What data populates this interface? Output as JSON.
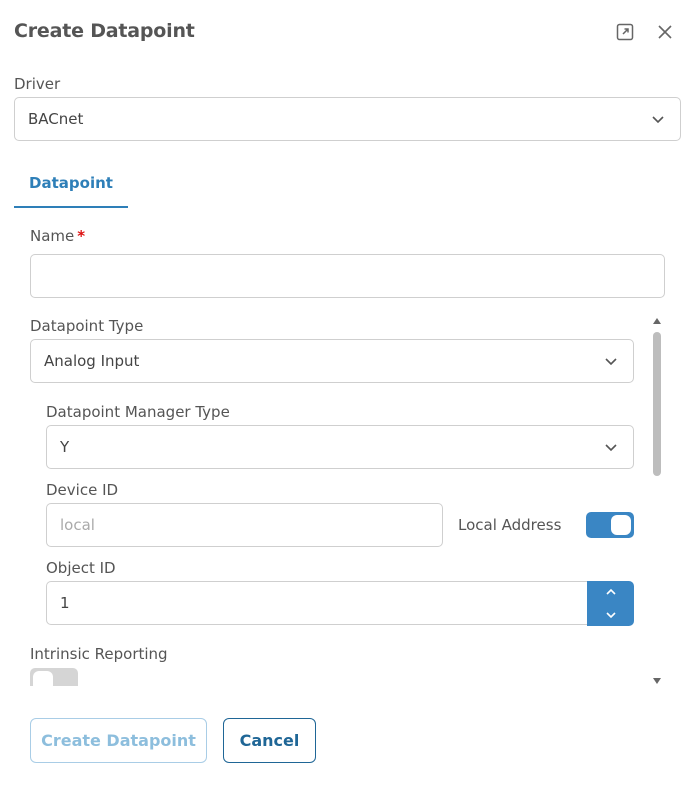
{
  "dialog": {
    "title": "Create Datapoint",
    "expand_icon": "expand-icon",
    "close_icon": "close-icon"
  },
  "driver": {
    "label": "Driver",
    "value": "BACnet"
  },
  "tabs": [
    {
      "label": "Datapoint",
      "active": true
    }
  ],
  "form": {
    "name": {
      "label": "Name",
      "required_mark": "*",
      "value": ""
    },
    "datapoint_type": {
      "label": "Datapoint Type",
      "value": "Analog Input"
    },
    "manager_type": {
      "label": "Datapoint Manager Type",
      "value": "Y"
    },
    "device_id": {
      "label": "Device ID",
      "placeholder": "local"
    },
    "local_address": {
      "label": "Local Address",
      "enabled": true
    },
    "object_id": {
      "label": "Object ID",
      "value": "1"
    },
    "intrinsic_reporting": {
      "label": "Intrinsic Reporting",
      "enabled": false
    }
  },
  "actions": {
    "create_label": "Create Datapoint",
    "cancel_label": "Cancel"
  },
  "colors": {
    "accent": "#3a86c4",
    "tab_active": "#2e7fb8",
    "cancel_border": "#1f6696",
    "required": "#dd1111"
  }
}
